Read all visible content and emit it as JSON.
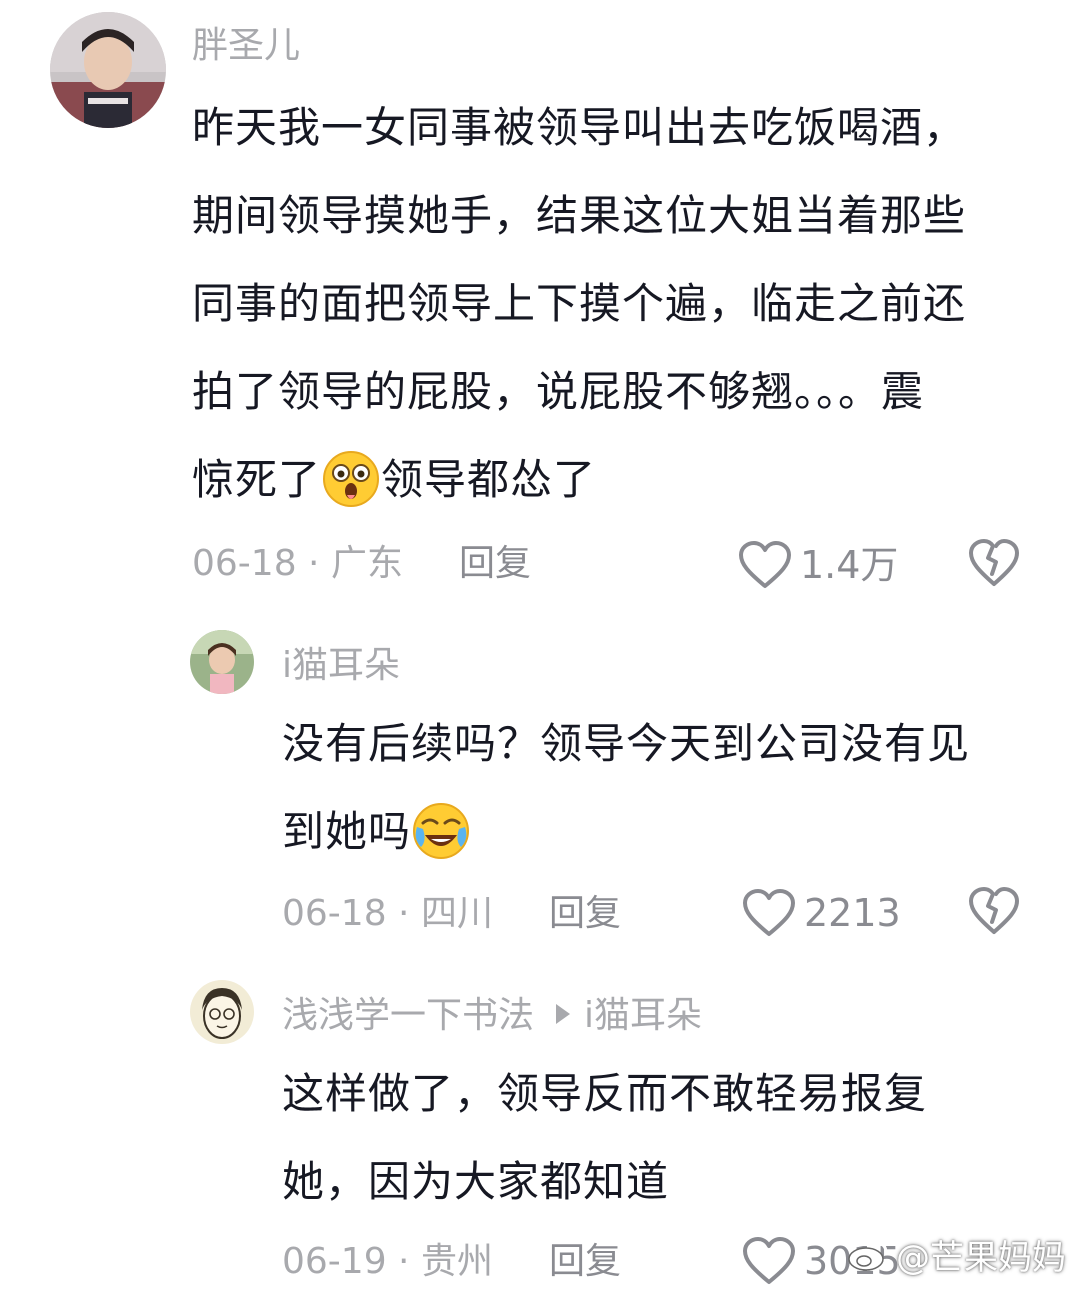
{
  "comments": [
    {
      "username": "胖圣儿",
      "lines": [
        "昨天我一女同事被领导叫出去吃饭喝酒，",
        "期间领导摸她手，结果这位大姐当着那些",
        "同事的面把领导上下摸个遍，临走之前还",
        "拍了领导的屁股，说屁股不够翘。。。震"
      ],
      "last_line_before_emoji": "惊死了",
      "emoji_icon": "shocked-face-emoji",
      "last_line_after_emoji": "领导都怂了",
      "date_location": "06-18 · 广东",
      "reply_label": "回复",
      "likes": "1.4万"
    },
    {
      "username": "i猫耳朵",
      "lines": [
        "没有后续吗？领导今天到公司没有见"
      ],
      "last_line_before_emoji": "到她吗",
      "emoji_icon": "crying-laughing-emoji",
      "last_line_after_emoji": "",
      "date_location": "06-18 · 四川",
      "reply_label": "回复",
      "likes": "2213"
    },
    {
      "username": "浅浅学一下书法",
      "reply_to": "i猫耳朵",
      "lines": [
        "这样做了，领导反而不敢轻易报复",
        "她，因为大家都知道"
      ],
      "date_location": "06-19 · 贵州",
      "reply_label": "回复",
      "likes": "3015"
    }
  ],
  "watermark": "@芒果妈妈",
  "colors": {
    "text": "#161823",
    "meta": "#a8a9ad",
    "icon": "#8a8b91",
    "emoji_yellow": "#ffcc33"
  }
}
